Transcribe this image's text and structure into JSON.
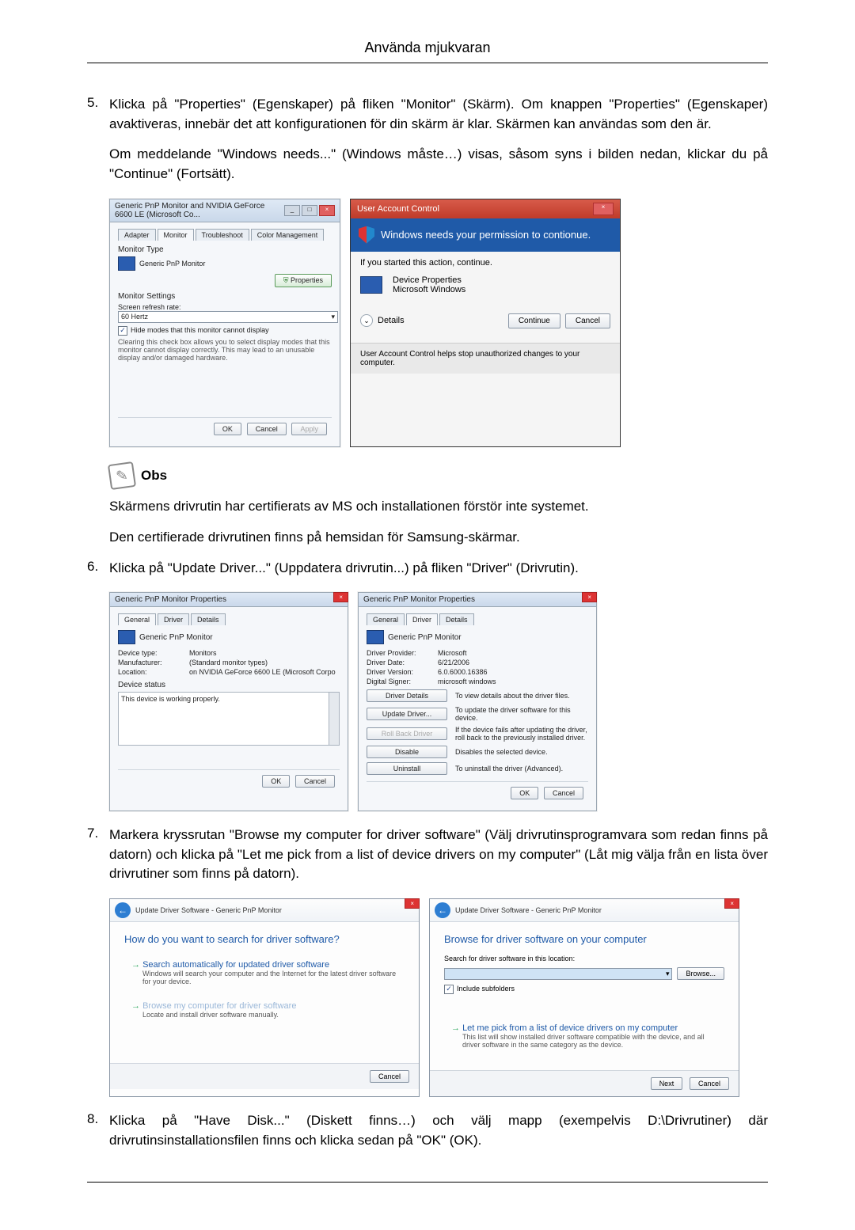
{
  "header": {
    "title": "Använda mjukvaran"
  },
  "steps": {
    "s5": {
      "num": "5.",
      "p1": "Klicka på \"Properties\" (Egenskaper) på fliken \"Monitor\" (Skärm). Om knappen \"Properties\" (Egenskaper) avaktiveras, innebär det att konfigurationen för din skärm är klar. Skärmen kan användas som den är.",
      "p2": "Om meddelande \"Windows needs...\" (Windows måste…) visas, såsom syns i bilden nedan, klickar du på \"Continue\" (Fortsätt)."
    },
    "s6": {
      "num": "6.",
      "p1": "Klicka på \"Update Driver...\" (Uppdatera drivrutin...) på fliken \"Driver\" (Drivrutin)."
    },
    "s7": {
      "num": "7.",
      "p1": "Markera kryssrutan \"Browse my computer for driver software\" (Välj drivrutinsprogramvara som redan finns på datorn) och klicka på \"Let me pick from a list of device drivers on my computer\" (Låt mig välja från en lista över drivrutiner som finns på datorn)."
    },
    "s8": {
      "num": "8.",
      "p1": "Klicka på \"Have Disk...\" (Diskett finns…) och välj mapp (exempelvis D:\\Drivrutiner) där drivrutinsinstallationsfilen finns och klicka sedan på \"OK\" (OK)."
    }
  },
  "note": {
    "label": "Obs",
    "l1": "Skärmens drivrutin har certifierats av MS och installationen förstör inte systemet.",
    "l2": "Den certifierade drivrutinen finns på hemsidan för Samsung-skärmar."
  },
  "dlg1": {
    "title": "Generic PnP Monitor and NVIDIA GeForce 6600 LE (Microsoft Co...",
    "tabs": {
      "adapter": "Adapter",
      "monitor": "Monitor",
      "trouble": "Troubleshoot",
      "color": "Color Management"
    },
    "monitor_type": "Monitor Type",
    "monitor_name": "Generic PnP Monitor",
    "properties_btn": "Properties",
    "settings": "Monitor Settings",
    "refresh_label": "Screen refresh rate:",
    "refresh_value": "60 Hertz",
    "hide_label": "Hide modes that this monitor cannot display",
    "hide_desc": "Clearing this check box allows you to select display modes that this monitor cannot display correctly. This may lead to an unusable display and/or damaged hardware.",
    "ok": "OK",
    "cancel": "Cancel",
    "apply": "Apply"
  },
  "uac": {
    "title": "User Account Control",
    "headline": "Windows needs your permission to contionue.",
    "started": "If you started this action, continue.",
    "dev_props": "Device Properties",
    "ms_win": "Microsoft Windows",
    "details": "Details",
    "continue": "Continue",
    "cancel": "Cancel",
    "footer": "User Account Control helps stop unauthorized changes to your computer."
  },
  "propA": {
    "title": "Generic PnP Monitor Properties",
    "tabs": {
      "general": "General",
      "driver": "Driver",
      "details": "Details"
    },
    "name": "Generic PnP Monitor",
    "dt_l": "Device type:",
    "dt_v": "Monitors",
    "mf_l": "Manufacturer:",
    "mf_v": "(Standard monitor types)",
    "loc_l": "Location:",
    "loc_v": "on NVIDIA GeForce 6600 LE (Microsoft Corpo",
    "status_h": "Device status",
    "status_t": "This device is working properly.",
    "ok": "OK",
    "cancel": "Cancel"
  },
  "propB": {
    "title": "Generic PnP Monitor Properties",
    "name": "Generic PnP Monitor",
    "dp_l": "Driver Provider:",
    "dp_v": "Microsoft",
    "dd_l": "Driver Date:",
    "dd_v": "6/21/2006",
    "dv_l": "Driver Version:",
    "dv_v": "6.0.6000.16386",
    "ds_l": "Digital Signer:",
    "ds_v": "microsoft windows",
    "b_details": "Driver Details",
    "d_details": "To view details about the driver files.",
    "b_update": "Update Driver...",
    "d_update": "To update the driver software for this device.",
    "b_roll": "Roll Back Driver",
    "d_roll": "If the device fails after updating the driver, roll back to the previously installed driver.",
    "b_disable": "Disable",
    "d_disable": "Disables the selected device.",
    "b_uninstall": "Uninstall",
    "d_uninstall": "To uninstall the driver (Advanced).",
    "ok": "OK",
    "cancel": "Cancel"
  },
  "wizA": {
    "crumb": "Update Driver Software - Generic PnP Monitor",
    "h": "How do you want to search for driver software?",
    "o1t": "Search automatically for updated driver software",
    "o1s": "Windows will search your computer and the Internet for the latest driver software for your device.",
    "o2t": "Browse my computer for driver software",
    "o2s": "Locate and install driver software manually.",
    "cancel": "Cancel"
  },
  "wizB": {
    "crumb": "Update Driver Software - Generic PnP Monitor",
    "h": "Browse for driver software on your computer",
    "loc_label": "Search for driver software in this location:",
    "path": "",
    "browse": "Browse...",
    "include": "Include subfolders",
    "o1t": "Let me pick from a list of device drivers on my computer",
    "o1s": "This list will show installed driver software compatible with the device, and all driver software in the same category as the device.",
    "next": "Next",
    "cancel": "Cancel"
  }
}
